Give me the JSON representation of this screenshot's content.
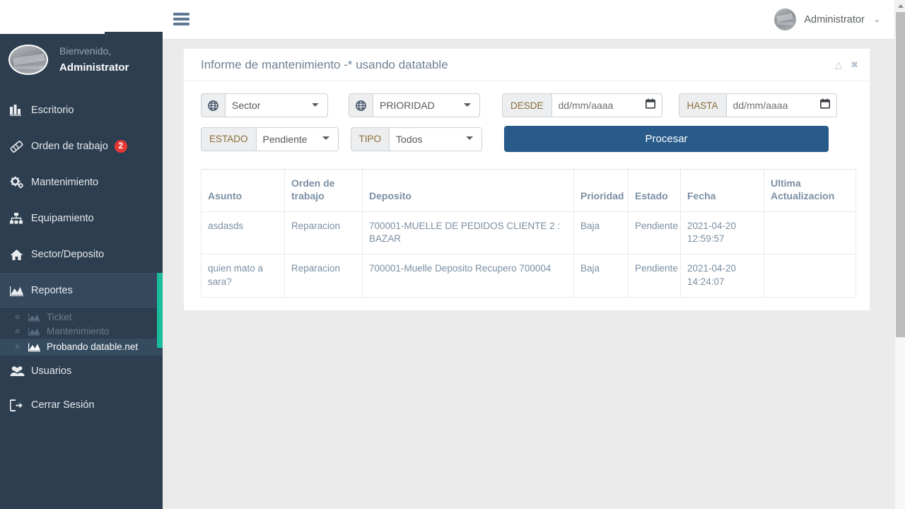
{
  "header": {
    "menu_toggle_label": "menu-toggle",
    "user_name": "Administrator",
    "caret": "⌄"
  },
  "sidebar": {
    "welcome_label": "Bienvenido,",
    "user_name": "Administrator",
    "items": [
      {
        "label": "Escritorio",
        "icon": "chart-bar-icon",
        "badge": ""
      },
      {
        "label": "Orden de trabajo",
        "icon": "ticket-icon",
        "badge": "2"
      },
      {
        "label": "Mantenimiento",
        "icon": "gears-icon",
        "badge": ""
      },
      {
        "label": "Equipamiento",
        "icon": "sitemap-icon",
        "badge": ""
      },
      {
        "label": "Sector/Deposito",
        "icon": "home-icon",
        "badge": ""
      },
      {
        "label": "Reportes",
        "icon": "area-chart-icon",
        "badge": ""
      },
      {
        "label": "Usuarios",
        "icon": "users-icon",
        "badge": ""
      },
      {
        "label": "Cerrar Sesión",
        "icon": "sign-out-icon",
        "badge": ""
      }
    ],
    "reportes_submenu": [
      {
        "label": "Ticket",
        "icon": "area-chart-icon",
        "state": "dim"
      },
      {
        "label": "Mantenimiento",
        "icon": "area-chart-icon",
        "state": "dim"
      },
      {
        "label": "Probando datable.net",
        "icon": "area-chart-icon",
        "state": "current"
      }
    ],
    "accent_color": "#1abc9c",
    "bg_color": "#2c3e50",
    "badge_color": "#e53935"
  },
  "panel": {
    "title": "Informe de mantenimiento -* usando datatable",
    "collapse_icon": "chevron-up-icon",
    "close_icon": "close-icon"
  },
  "filters": {
    "sector": {
      "icon": "globe-icon",
      "value": "Sector",
      "options": [
        "Sector"
      ]
    },
    "prioridad": {
      "icon": "globe-icon",
      "value": "PRIORIDAD",
      "options": [
        "PRIORIDAD"
      ]
    },
    "desde": {
      "label": "DESDE",
      "placeholder": "dd/mm/aaaa",
      "value": "",
      "icon": "calendar-icon"
    },
    "hasta": {
      "label": "HASTA",
      "placeholder": "dd/mm/aaaa",
      "value": "",
      "icon": "calendar-icon"
    },
    "estado": {
      "label": "ESTADO",
      "value": "Pendiente",
      "options": [
        "Pendiente"
      ]
    },
    "tipo": {
      "label": "TIPO",
      "value": "Todos",
      "options": [
        "Todos"
      ]
    },
    "procesar_label": "Procesar",
    "procesar_color": "#285b8a"
  },
  "table": {
    "columns": [
      "Asunto",
      "Orden de trabajo",
      "Deposito",
      "Prioridad",
      "Estado",
      "Fecha",
      "Ultima Actualizacion"
    ],
    "rows": [
      {
        "asunto": "asdasds",
        "orden_de_trabajo": "Reparacion",
        "deposito": "700001-MUELLE DE PEDIDOS CLIENTE 2 : BAZAR",
        "prioridad": "Baja",
        "estado": "Pendiente",
        "fecha": "2021-04-20 12:59:57",
        "ultima_actualizacion": ""
      },
      {
        "asunto": "quien mato a sara?",
        "orden_de_trabajo": "Reparacion",
        "deposito": "700001-Muelle Deposito Recupero 700004",
        "prioridad": "Baja",
        "estado": "Pendiente",
        "fecha": "2021-04-20 14:24:07",
        "ultima_actualizacion": ""
      }
    ]
  }
}
